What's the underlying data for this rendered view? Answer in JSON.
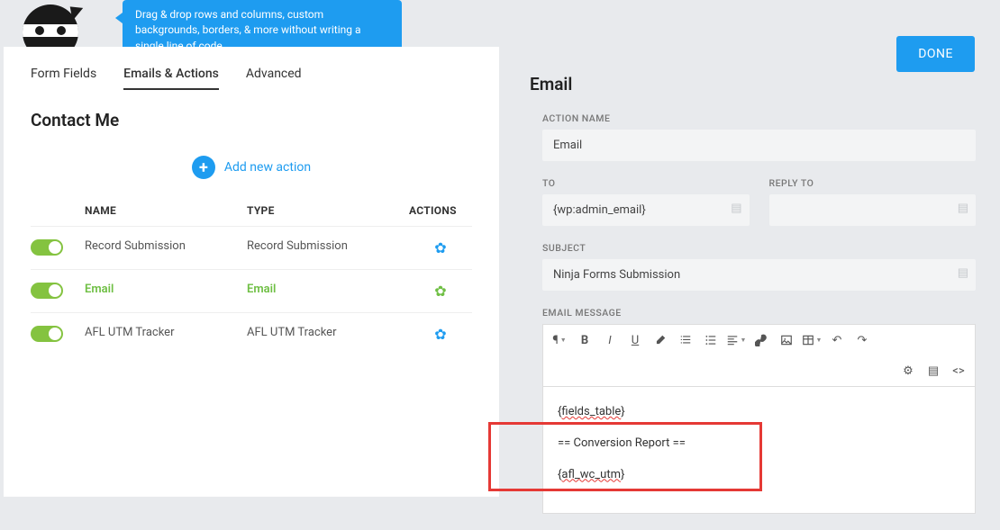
{
  "tip": "Drag & drop rows and columns, custom backgrounds, borders, & more without writing a single line of code.",
  "done": "DONE",
  "tabs": [
    "Form Fields",
    "Emails & Actions",
    "Advanced"
  ],
  "activeTab": 1,
  "formTitle": "Contact Me",
  "addAction": "Add new action",
  "tableHead": {
    "name": "NAME",
    "type": "TYPE",
    "actions": "ACTIONS"
  },
  "rows": [
    {
      "name": "Record Submission",
      "type": "Record Submission",
      "highlight": false
    },
    {
      "name": "Email",
      "type": "Email",
      "highlight": true
    },
    {
      "name": "AFL UTM Tracker",
      "type": "AFL UTM Tracker",
      "highlight": false
    }
  ],
  "panelTitle": "Email",
  "fields": {
    "actionNameLabel": "ACTION NAME",
    "actionName": "Email",
    "toLabel": "TO",
    "to": "{wp:admin_email}",
    "replyLabel": "REPLY TO",
    "reply": "",
    "subjectLabel": "SUBJECT",
    "subject": "Ninja Forms Submission",
    "messageLabel": "EMAIL MESSAGE"
  },
  "editor": {
    "line1a": "{",
    "line1b": "fields_table",
    "line1c": "}",
    "line2": "== Conversion Report ==",
    "line3a": "{",
    "line3b": "afl_wc_utm",
    "line3c": "}"
  }
}
